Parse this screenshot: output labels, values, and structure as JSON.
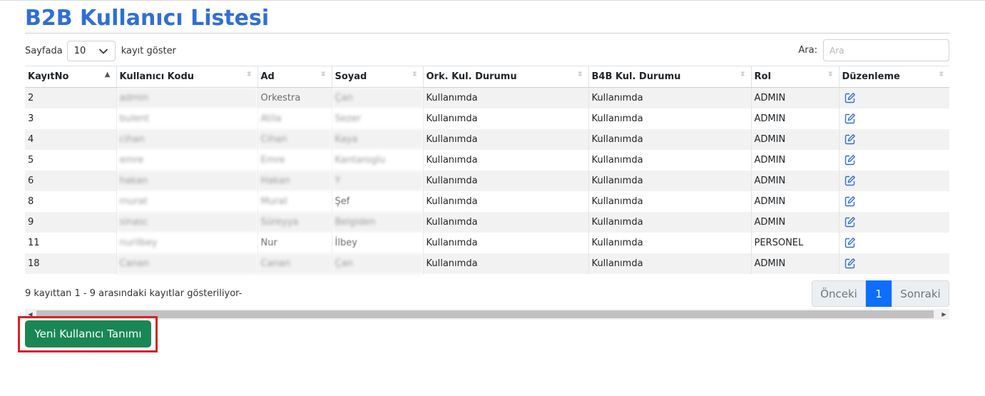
{
  "page": {
    "title": "B2B Kullanıcı Listesi"
  },
  "length_menu": {
    "prefix": "Sayfada",
    "selected": "10",
    "suffix": "kayıt göster"
  },
  "search": {
    "label": "Ara:",
    "placeholder": "Ara"
  },
  "table": {
    "columns": [
      "KayıtNo",
      "Kullanıcı Kodu",
      "Ad",
      "Soyad",
      "Ork. Kul. Durumu",
      "B4B Kul. Durumu",
      "Rol",
      "Düzenleme"
    ],
    "sorted_column": "KayıtNo",
    "rows": [
      {
        "no": "2",
        "code": "admin",
        "ad": "Orkestra",
        "soyad": "Çan",
        "ork": "Kullanımda",
        "b4b": "Kullanımda",
        "rol": "ADMIN"
      },
      {
        "no": "3",
        "code": "bulent",
        "ad": "Atila",
        "soyad": "Sezer",
        "ork": "Kullanımda",
        "b4b": "Kullanımda",
        "rol": "ADMIN"
      },
      {
        "no": "4",
        "code": "cihan",
        "ad": "Cihan",
        "soyad": "Kaya",
        "ork": "Kullanımda",
        "b4b": "Kullanımda",
        "rol": "ADMIN"
      },
      {
        "no": "5",
        "code": "emre",
        "ad": "Emre",
        "soyad": "Kantaroglu",
        "ork": "Kullanımda",
        "b4b": "Kullanımda",
        "rol": "ADMIN"
      },
      {
        "no": "6",
        "code": "hakan",
        "ad": "Hakan",
        "soyad": "Y",
        "ork": "Kullanımda",
        "b4b": "Kullanımda",
        "rol": "ADMIN"
      },
      {
        "no": "8",
        "code": "murat",
        "ad": "Murat",
        "soyad": "Şef",
        "ork": "Kullanımda",
        "b4b": "Kullanımda",
        "rol": "ADMIN"
      },
      {
        "no": "9",
        "code": "sinasc",
        "ad": "Süreyya",
        "soyad": "Belgiden",
        "ork": "Kullanımda",
        "b4b": "Kullanımda",
        "rol": "ADMIN"
      },
      {
        "no": "11",
        "code": "nurilbey",
        "ad": "Nur",
        "soyad": "İlbey",
        "ork": "Kullanımda",
        "b4b": "Kullanımda",
        "rol": "PERSONEL"
      },
      {
        "no": "18",
        "code": "Canan",
        "ad": "Canan",
        "soyad": "Çan",
        "ork": "Kullanımda",
        "b4b": "Kullanımda",
        "rol": "ADMIN"
      }
    ]
  },
  "info": "9 kayıttan 1 - 9 arasındaki kayıtlar gösteriliyor-",
  "pagination": {
    "prev": "Önceki",
    "current": "1",
    "next": "Sonraki"
  },
  "new_user_button": "Yeni Kullanıcı Tanımı",
  "colors": {
    "title": "#2f6fd6",
    "primary": "#0d6efd",
    "success": "#198754",
    "highlight": "#d92027"
  },
  "icons": {
    "edit": "edit-icon",
    "dropdown": "chevron-down-icon",
    "sort": "sort-icon"
  }
}
